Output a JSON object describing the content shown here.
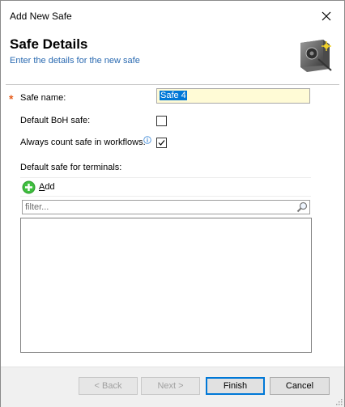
{
  "window": {
    "title": "Add New Safe"
  },
  "header": {
    "title": "Safe Details",
    "subtitle": "Enter the details for the new safe"
  },
  "form": {
    "safe_name_label": "Safe name:",
    "safe_name_value": "Safe 4",
    "default_boh_label": "Default BoH safe:",
    "default_boh_checked": false,
    "always_count_label": "Always count safe in workflows:",
    "always_count_checked": true,
    "default_terminals_label": "Default safe for terminals:"
  },
  "terminals": {
    "add_label_prefix": "",
    "add_label_underlined": "A",
    "add_label_rest": "dd",
    "filter_placeholder": "filter..."
  },
  "footer": {
    "back_label": "< Back",
    "next_label": "Next >",
    "finish_label": "Finish",
    "cancel_label": "Cancel"
  },
  "colors": {
    "accent": "#0078d7",
    "subtitle": "#2a6ab1",
    "required": "#e65d1c",
    "name_field_bg": "#fffbd6"
  }
}
